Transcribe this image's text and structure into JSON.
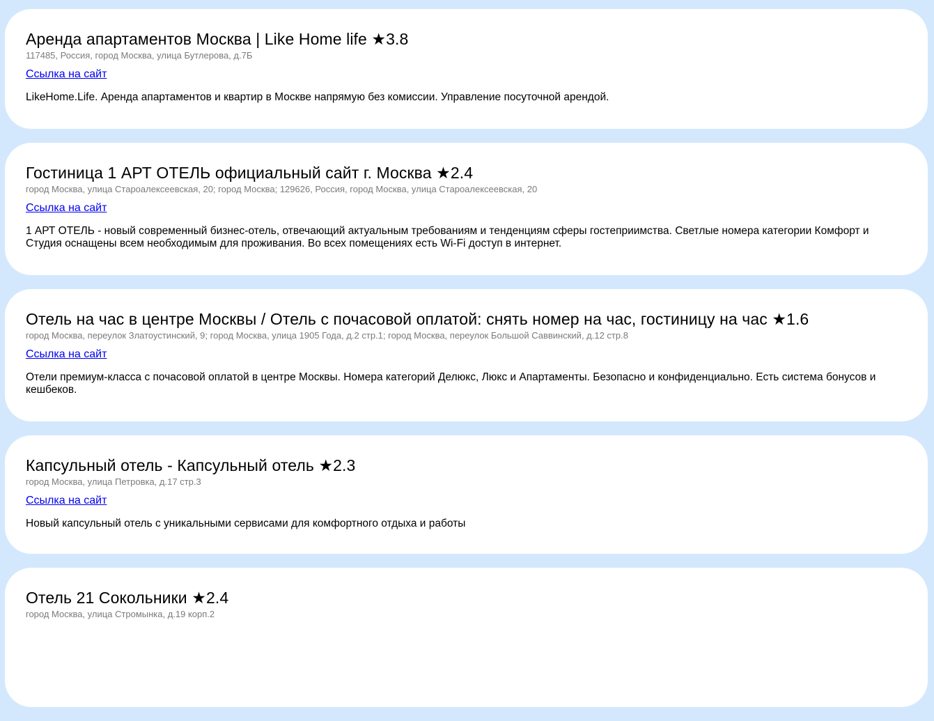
{
  "listings": [
    {
      "title": "Аренда апартаментов Москва | Like Home life ★3.8",
      "address": "117485, Россия, город Москва, улица Бутлерова, д.7Б",
      "link_label": "Ссылка на сайт",
      "description": "LikeHome.Life. Аренда апартаментов и квартир в Москве напрямую без комиссии. Управление посуточной арендой."
    },
    {
      "title": "Гостиница 1 АРТ ОТЕЛЬ официальный сайт г. Москва ★2.4",
      "address": "город Москва, улица Староалексеевская, 20; город Москва; 129626, Россия, город Москва, улица Староалексеевская, 20",
      "link_label": "Ссылка на сайт",
      "description": "1 АРТ ОТЕЛЬ - новый современный бизнес-отель, отвечающий актуальным требованиям и тенденциям сферы гостеприимства. Светлые номера категории Комфорт и Студия оснащены всем необходимым для проживания. Во всех помещениях есть Wi-Fi доступ в интернет."
    },
    {
      "title": "Отель на час в центре Москвы / Отель с почасовой оплатой: снять номер на час, гостиницу на час ★1.6",
      "address": "город Москва, переулок Златоустинский, 9; город Москва, улица 1905 Года, д.2 стр.1; город Москва, переулок Большой Саввинский, д.12 стр.8",
      "link_label": "Ссылка на сайт",
      "description": "Отели премиум-класса с почасовой оплатой в центре Москвы. Номера категорий Делюкс, Люкс и Апартаменты. Безопасно и конфиденциально. Есть система бонусов и кешбеков."
    },
    {
      "title": "Капсульный отель - Капсульный отель ★2.3",
      "address": "город Москва, улица Петровка, д.17 стр.3",
      "link_label": "Ссылка на сайт",
      "description": "Новый капсульный отель с уникальными сервисами для комфортного отдыха и работы"
    },
    {
      "title": "Отель 21 Сокольники ★2.4",
      "address": "город Москва, улица Стромынка, д.19 корп.2",
      "link_label": "",
      "description": ""
    }
  ]
}
